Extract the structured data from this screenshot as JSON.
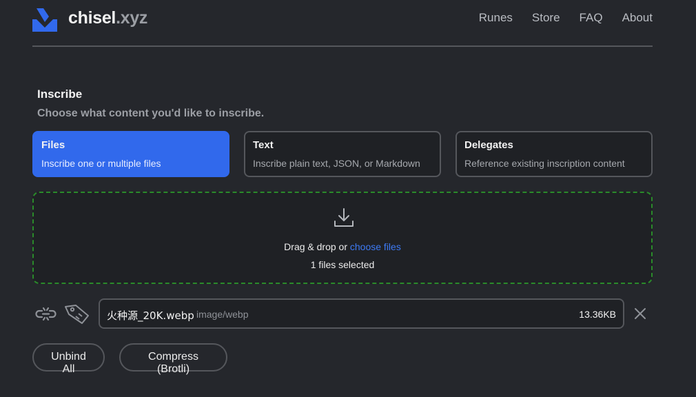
{
  "header": {
    "brand_main": "chisel",
    "brand_ext": ".xyz",
    "nav": [
      "Runes",
      "Store",
      "FAQ",
      "About"
    ]
  },
  "section": {
    "title": "Inscribe",
    "subtitle": "Choose what content you'd like to inscribe."
  },
  "tabs": [
    {
      "title": "Files",
      "desc": "Inscribe one or multiple files",
      "active": true
    },
    {
      "title": "Text",
      "desc": "Inscribe plain text, JSON, or Markdown",
      "active": false
    },
    {
      "title": "Delegates",
      "desc": "Reference existing inscription content",
      "active": false
    }
  ],
  "dropzone": {
    "prefix": "Drag & drop or ",
    "link": "choose files",
    "status": "1 files selected"
  },
  "file": {
    "name": "火种源_20K.webp",
    "type": "image/webp",
    "size": "13.36KB"
  },
  "actions": {
    "unbind_all": "Unbind All",
    "compress": "Compress (Brotli)"
  },
  "colors": {
    "background": "#25272c",
    "accent": "#3169ec",
    "link": "#3d7af5",
    "dropzone_border": "#2a8a2a"
  },
  "icons": [
    "chisel-logo-icon",
    "download-icon",
    "unlink-icon",
    "tag-icon",
    "close-icon"
  ]
}
